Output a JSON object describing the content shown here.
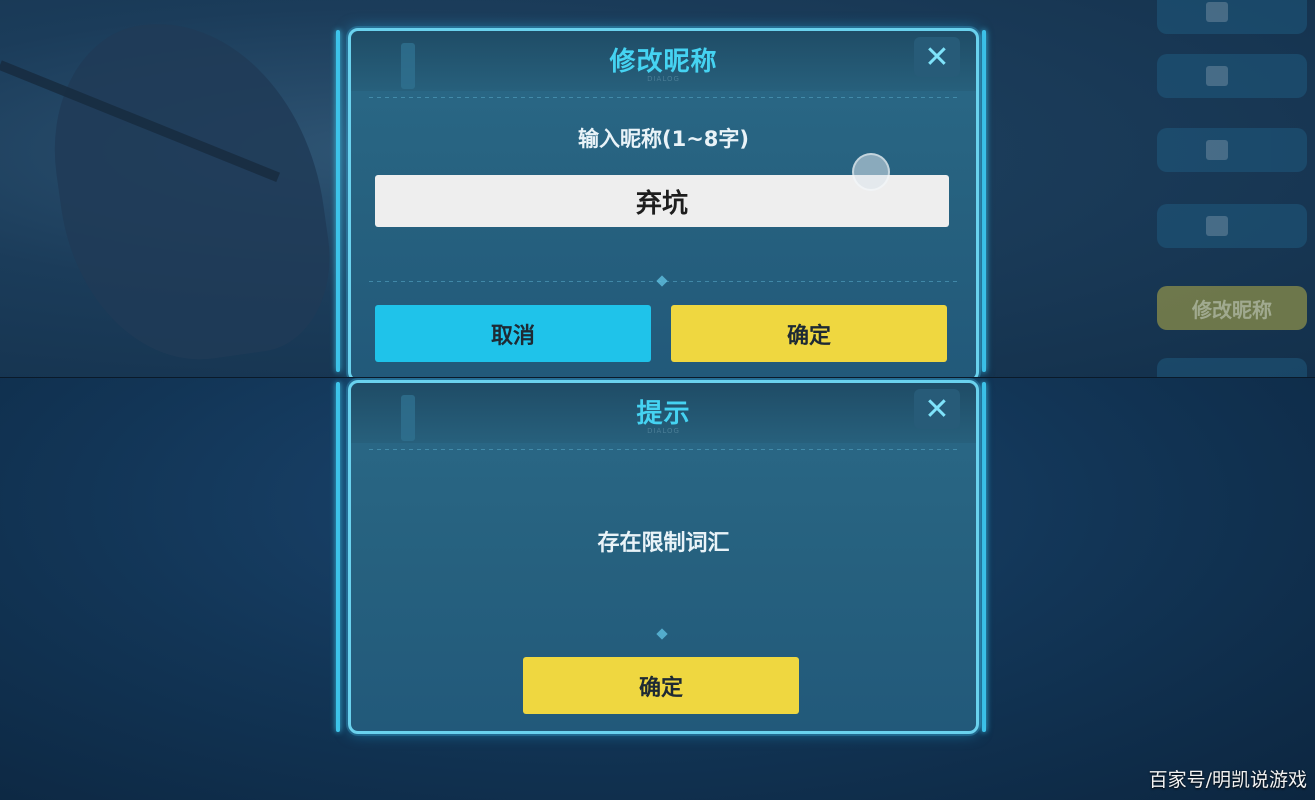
{
  "rename_dialog": {
    "title": "修改昵称",
    "subtitle": "DIALOG",
    "close_symbol": "✕",
    "prompt": "输入昵称(1~8字)",
    "input_value": "弃坑",
    "cancel_label": "取消",
    "confirm_label": "确定"
  },
  "notice_dialog": {
    "title": "提示",
    "subtitle": "DIALOG",
    "close_symbol": "✕",
    "message": "存在限制词汇",
    "confirm_label": "确定"
  },
  "side_menu": {
    "rename_label": "修改昵称"
  },
  "watermark": "百家号/明凯说游戏",
  "colors": {
    "accent_cyan": "#45d3f2",
    "button_cyan": "#1fc3ea",
    "button_yellow": "#efd740",
    "dialog_bg": "#26617f"
  }
}
